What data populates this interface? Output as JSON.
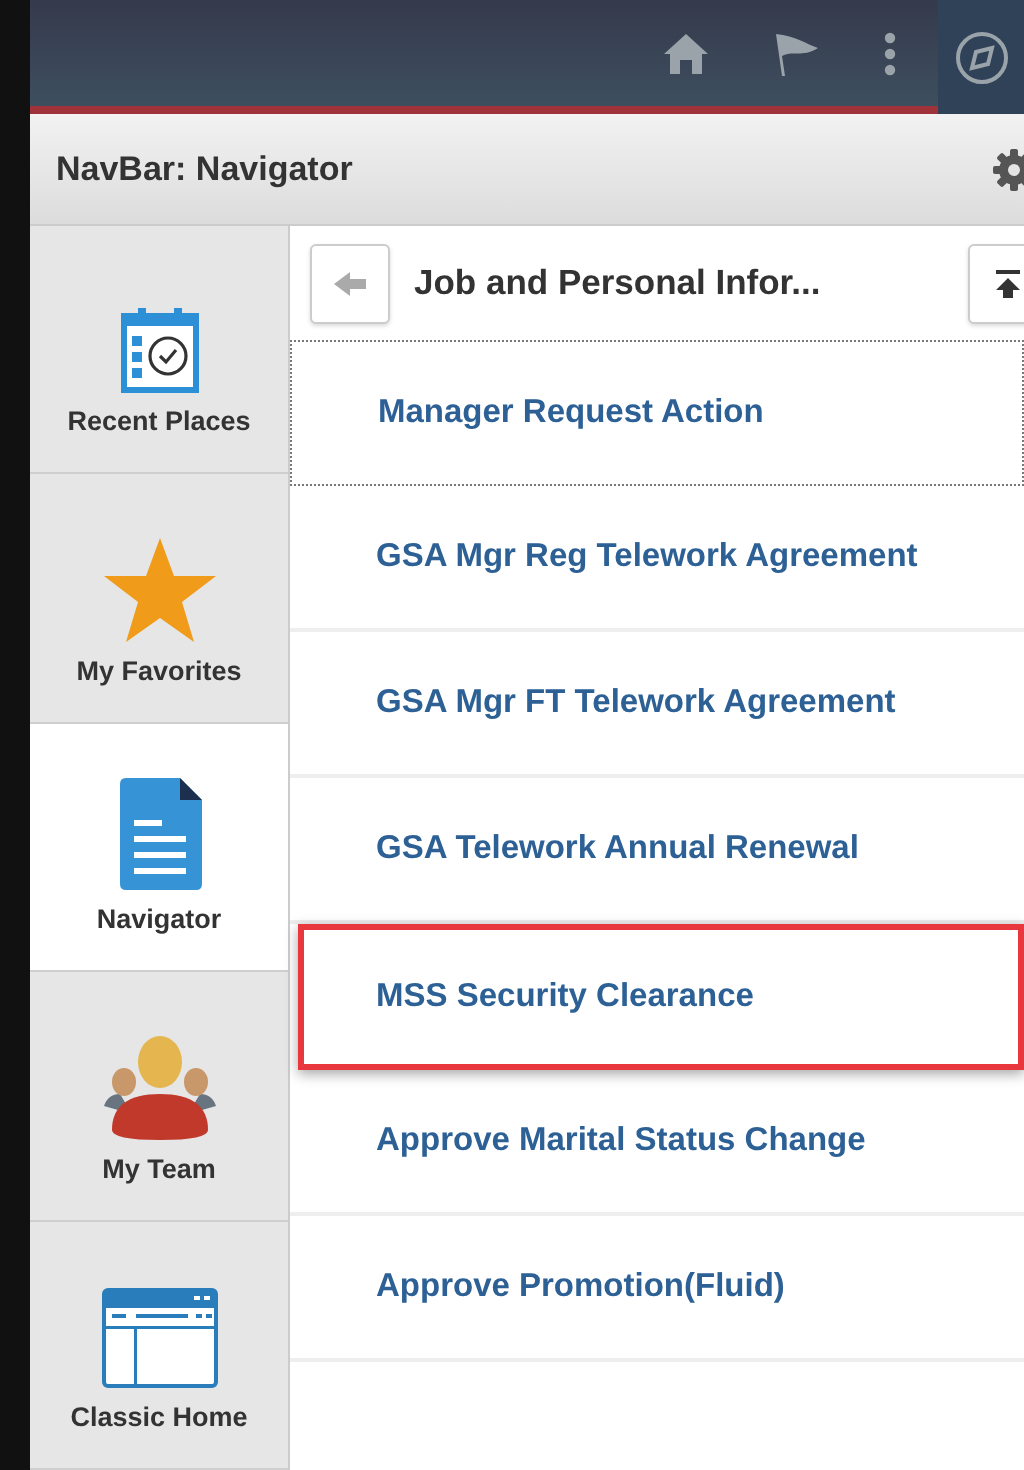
{
  "navbar_title": "NavBar: Navigator",
  "sidebar": {
    "items": [
      {
        "label": "Recent Places",
        "kind": "recent",
        "selected": false
      },
      {
        "label": "My Favorites",
        "kind": "favorites",
        "selected": false
      },
      {
        "label": "Navigator",
        "kind": "navigator",
        "selected": true
      },
      {
        "label": "My Team",
        "kind": "team",
        "selected": false
      },
      {
        "label": "Classic Home",
        "kind": "classic",
        "selected": false
      }
    ]
  },
  "folder": {
    "title": "Job and Personal Infor..."
  },
  "links": [
    {
      "label": "Manager Request Action",
      "focused": true,
      "highlighted": false
    },
    {
      "label": "GSA Mgr Reg Telework Agreement",
      "focused": false,
      "highlighted": false
    },
    {
      "label": "GSA Mgr FT Telework Agreement",
      "focused": false,
      "highlighted": false
    },
    {
      "label": "GSA Telework Annual Renewal",
      "focused": false,
      "highlighted": false
    },
    {
      "label": "MSS Security Clearance",
      "focused": false,
      "highlighted": true
    },
    {
      "label": "Approve Marital Status Change",
      "focused": false,
      "highlighted": false
    },
    {
      "label": "Approve Promotion(Fluid)",
      "focused": false,
      "highlighted": false
    }
  ]
}
